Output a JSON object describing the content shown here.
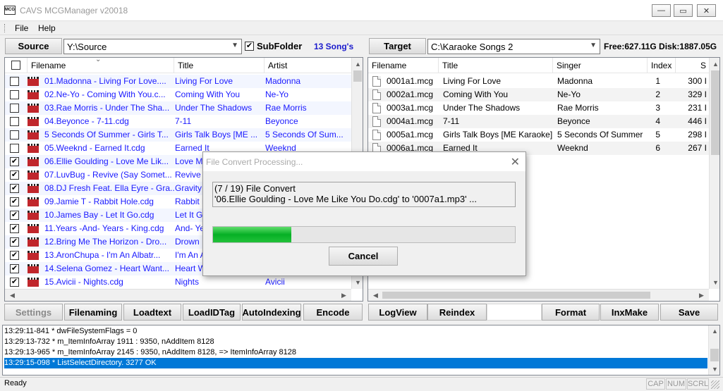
{
  "window": {
    "icon_label": "MCG",
    "title": "CAVS MCGManager v20018",
    "min_symbol": "—",
    "max_symbol": "▭",
    "close_symbol": "✕"
  },
  "menu": {
    "file": "File",
    "help": "Help"
  },
  "source_bar": {
    "button": "Source",
    "path": "Y:\\Source",
    "subfolder_label": "SubFolder",
    "subfolder_checked": "✔",
    "song_count": "13 Song's"
  },
  "target_bar": {
    "button": "Target",
    "path": "C:\\Karaoke Songs 2",
    "disk_info": "Free:627.11G Disk:1887.05G"
  },
  "source_list": {
    "columns": [
      "Filename",
      "Title",
      "Artist"
    ],
    "sort_indicator": "⌄",
    "rows": [
      {
        "check": "",
        "filename": "01.Madonna - Living For Love....",
        "title": "Living For Love",
        "artist": "Madonna"
      },
      {
        "check": "",
        "filename": "02.Ne-Yo - Coming With You.c...",
        "title": "Coming With You",
        "artist": "Ne-Yo"
      },
      {
        "check": "",
        "filename": "03.Rae Morris - Under The Sha...",
        "title": "Under The Shadows",
        "artist": "Rae Morris"
      },
      {
        "check": "",
        "filename": "04.Beyonce - 7-11.cdg",
        "title": "7-11",
        "artist": "Beyonce"
      },
      {
        "check": "",
        "filename": "5 Seconds Of Summer - Girls T...",
        "title": "Girls Talk Boys [ME ...",
        "artist": "5 Seconds Of Sum..."
      },
      {
        "check": "",
        "filename": "05.Weeknd - Earned It.cdg",
        "title": "Earned It",
        "artist": "Weeknd"
      },
      {
        "check": "✔",
        "filename": "06.Ellie Goulding - Love Me Lik...",
        "title": "Love M",
        "artist": ""
      },
      {
        "check": "✔",
        "filename": "07.LuvBug - Revive (Say Somet...",
        "title": "Revive (",
        "artist": ""
      },
      {
        "check": "✔",
        "filename": "08.DJ Fresh Feat. Ella Eyre - Gra...",
        "title": "Gravity",
        "artist": ""
      },
      {
        "check": "✔",
        "filename": "09.Jamie T - Rabbit Hole.cdg",
        "title": "Rabbit H",
        "artist": ""
      },
      {
        "check": "✔",
        "filename": "10.James Bay - Let It Go.cdg",
        "title": "Let It G",
        "artist": ""
      },
      {
        "check": "✔",
        "filename": "11.Years -And- Years - King.cdg",
        "title": "And- Ye",
        "artist": ""
      },
      {
        "check": "✔",
        "filename": "12.Bring Me The Horizon - Dro...",
        "title": "Drown",
        "artist": ""
      },
      {
        "check": "✔",
        "filename": "13.AronChupa - I'm An Albatr...",
        "title": "I'm An A",
        "artist": ""
      },
      {
        "check": "✔",
        "filename": "14.Selena Gomez - Heart Want...",
        "title": "Heart W",
        "artist": ""
      },
      {
        "check": "✔",
        "filename": "15.Avicii - Nights.cdg",
        "title": "Nights",
        "artist": "Avicii"
      }
    ]
  },
  "target_list": {
    "columns": [
      "Filename",
      "Title",
      "Singer",
      "Index",
      "S"
    ],
    "rows": [
      {
        "filename": "0001a1.mcg",
        "title": "Living For Love",
        "singer": "Madonna",
        "index": "1",
        "size": "300 I"
      },
      {
        "filename": "0002a1.mcg",
        "title": "Coming With You",
        "singer": "Ne-Yo",
        "index": "2",
        "size": "329 I"
      },
      {
        "filename": "0003a1.mcg",
        "title": "Under The Shadows",
        "singer": "Rae Morris",
        "index": "3",
        "size": "231 I"
      },
      {
        "filename": "0004a1.mcg",
        "title": "7-11",
        "singer": "Beyonce",
        "index": "4",
        "size": "446 I"
      },
      {
        "filename": "0005a1.mcg",
        "title": "Girls Talk Boys [ME Karaoke]",
        "singer": "5 Seconds Of Summer",
        "index": "5",
        "size": "298 I"
      },
      {
        "filename": "0006a1.mcg",
        "title": "Earned It",
        "singer": "Weeknd",
        "index": "6",
        "size": "267 I"
      }
    ]
  },
  "scroll": {
    "up": "▲",
    "down": "▼",
    "left": "◀",
    "right": "▶"
  },
  "bottom_buttons": {
    "settings": "Settings",
    "filenaming": "Filenaming",
    "loadtext": "Loadtext",
    "loadidtag": "LoadIDTag",
    "autoindexing": "AutoIndexing",
    "encode": "Encode",
    "logview": "LogView",
    "reindex": "Reindex",
    "format": "Format",
    "inxmake": "InxMake",
    "save": "Save"
  },
  "log": {
    "lines": [
      "13:29:11-841 * dwFileSystemFlags = 0",
      "13:29:13-732 * m_ItemInfoArray 1911 : 9350, nAddItem 8128",
      "13:29:13-965 * m_ItemInfoArray 2145 : 9350, nAddItem 8128, => ItemInfoArray 8128",
      "13:29:15-098 * ListSelectDirectory. 3277 OK"
    ]
  },
  "status": {
    "ready": "Ready",
    "cap": "CAP",
    "num": "NUM",
    "scrl": "SCRL"
  },
  "dialog": {
    "title": "File Convert Processing...",
    "close": "✕",
    "line1": "(7 / 19) File Convert",
    "line2": "'06.Ellie Goulding - Love Me Like You Do.cdg' to '0007a1.mp3' ...",
    "progress": 0.26,
    "cancel": "Cancel"
  },
  "colors": {
    "link_blue": "#1a1aff",
    "selection": "#0078d7",
    "progress_green": "#06b025"
  }
}
